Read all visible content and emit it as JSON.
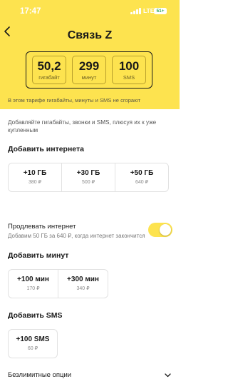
{
  "status_bar": {
    "time": "17:47",
    "network": "LTE",
    "battery": "51+"
  },
  "header": {
    "title": "Связь Z",
    "bg_color": "#fde34f"
  },
  "stats": [
    {
      "value": "50,2",
      "unit": "гигабайт"
    },
    {
      "value": "299",
      "unit": "минут"
    },
    {
      "value": "100",
      "unit": "SMS"
    }
  ],
  "note": "В этом тарифе гигабайты, минуты и SMS не сгорают",
  "intro": "Добавляйте гигабайты, звонки и SMS, плюсуя их к уже купленным",
  "internet": {
    "title": "Добавить интернета",
    "options": [
      {
        "amount": "+10 ГБ",
        "price": "380 ₽"
      },
      {
        "amount": "+30 ГБ",
        "price": "500 ₽"
      },
      {
        "amount": "+50 ГБ",
        "price": "640 ₽"
      }
    ]
  },
  "extend": {
    "label": "Продлевать интернет",
    "description": "Добавим 50 ГБ за 640 ₽, когда интернет закончится",
    "enabled": true
  },
  "minutes": {
    "title": "Добавить минут",
    "options": [
      {
        "amount": "+100 мин",
        "price": "170 ₽"
      },
      {
        "amount": "+300 мин",
        "price": "340 ₽"
      }
    ]
  },
  "sms": {
    "title": "Добавить SMS",
    "options": [
      {
        "amount": "+100 SMS",
        "price": "60 ₽"
      }
    ]
  },
  "unlimited": {
    "label": "Безлимитные опции"
  },
  "icons": {
    "back": "chevron-left-icon",
    "expand": "chevron-down-icon"
  }
}
